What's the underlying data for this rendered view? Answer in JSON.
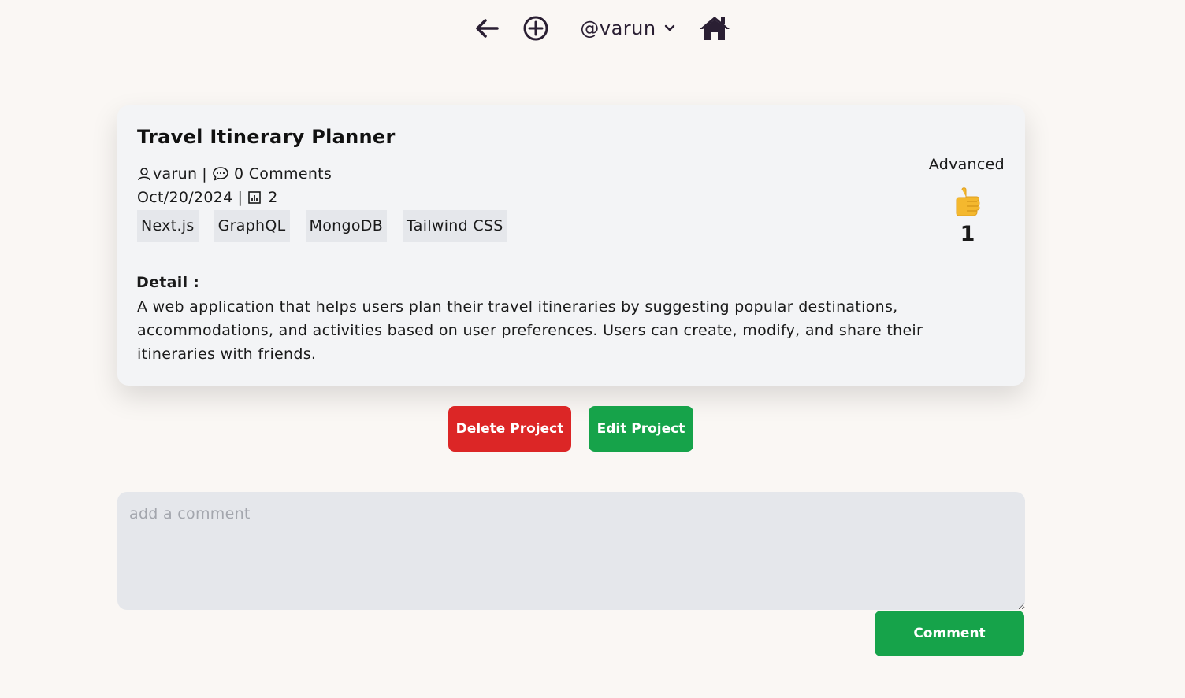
{
  "nav": {
    "back_icon": "arrow-left-icon",
    "add_icon": "plus-circle-icon",
    "username": "@varun",
    "dropdown_icon": "chevron-down-icon",
    "home_icon": "home-icon"
  },
  "project": {
    "title": "Travel Itinerary Planner",
    "author": "varun",
    "separator": "|",
    "comments_label": "0 Comments",
    "date": "Oct/20/2024",
    "views": "2",
    "tags": [
      "Next.js",
      "GraphQL",
      "MongoDB",
      "Tailwind CSS"
    ],
    "detail_heading": "Detail :",
    "detail_text": "A web application that helps users plan their travel itineraries by suggesting popular destinations, accommodations, and activities based on user preferences. Users can create, modify, and share their itineraries with friends.",
    "level": "Advanced",
    "like_emoji": "👍",
    "likes": "1"
  },
  "actions": {
    "delete_label": "Delete Project",
    "edit_label": "Edit Project"
  },
  "comment": {
    "placeholder": "add a comment",
    "value": "",
    "submit_label": "Comment"
  },
  "colors": {
    "background": "#faf7f4",
    "card": "#f3f4f6",
    "danger": "#dc2626",
    "success": "#16a34a",
    "nav_icon": "#2a1f33"
  }
}
